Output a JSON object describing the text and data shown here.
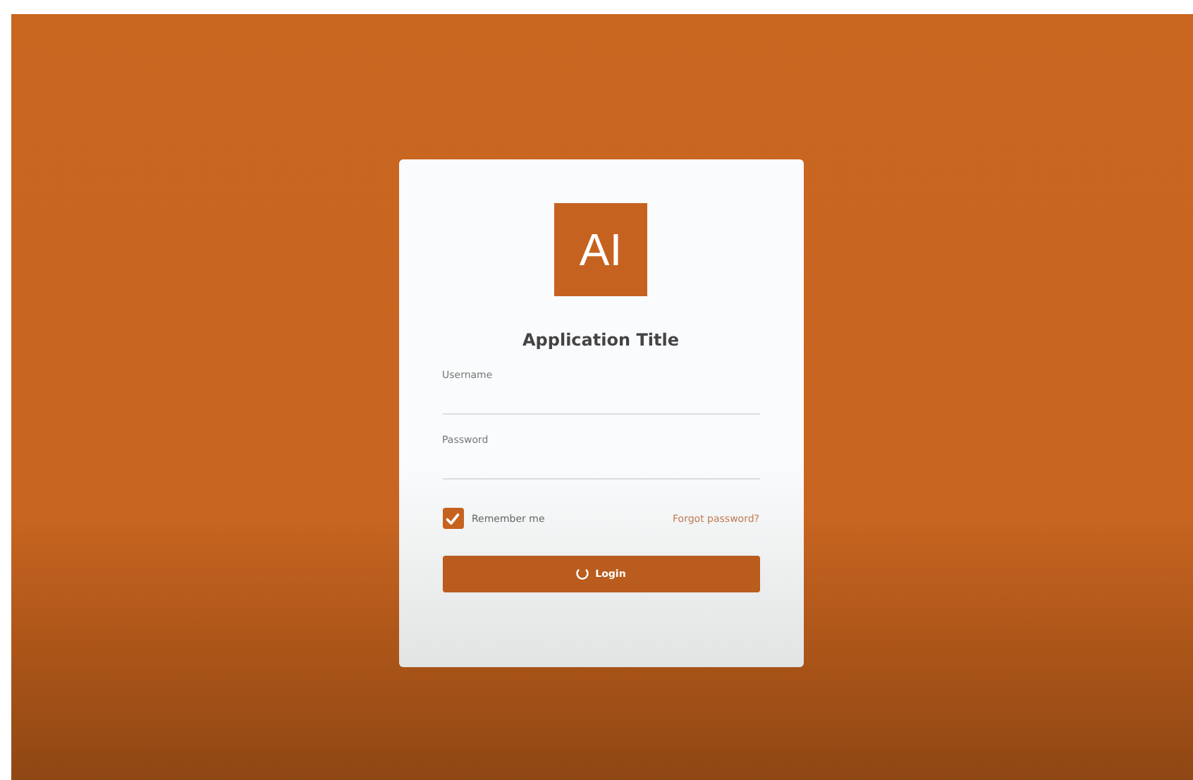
{
  "logo": {
    "text": "AI"
  },
  "title": "Application Title",
  "fields": [
    {
      "label": "Username"
    },
    {
      "label": "Password"
    }
  ],
  "remember": {
    "label": "Remember me",
    "checked": true
  },
  "forgot_link": "Forgot password?",
  "login_button": {
    "label": "Login",
    "loading": true
  }
}
